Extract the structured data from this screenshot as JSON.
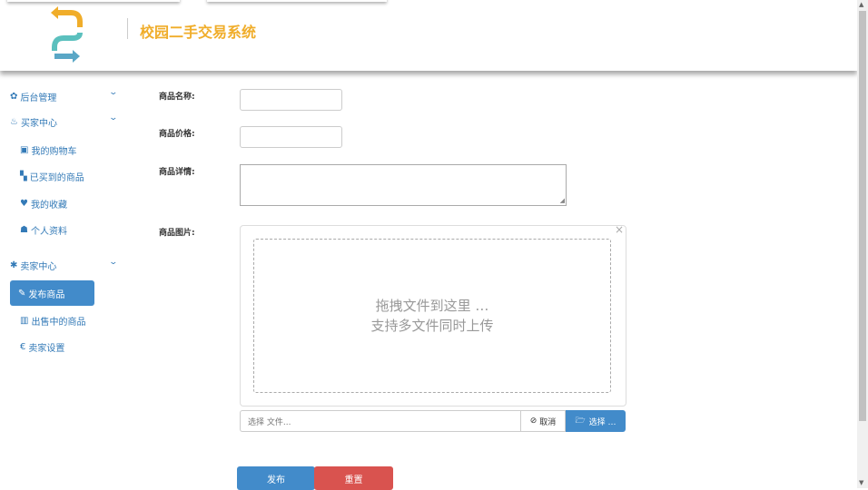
{
  "header": {
    "title": "校园二手交易系统"
  },
  "sidebar": {
    "sections": [
      {
        "label": "后台管理",
        "icon": "gear-icon"
      },
      {
        "label": "买家中心",
        "icon": "fire-icon"
      },
      {
        "label": "卖家中心",
        "icon": "asterisk-icon"
      }
    ],
    "buyer_items": [
      {
        "label": "我的购物车",
        "icon": "inbox-icon"
      },
      {
        "label": "已买到的商品",
        "icon": "gift-icon"
      },
      {
        "label": "我的收藏",
        "icon": "heart-icon"
      },
      {
        "label": "个人资料",
        "icon": "user-icon"
      }
    ],
    "seller_items": [
      {
        "label": "发布商品",
        "icon": "pencil-icon",
        "active": true
      },
      {
        "label": "出售中的商品",
        "icon": "barcode-icon"
      },
      {
        "label": "卖家设置",
        "icon": "euro-icon"
      }
    ]
  },
  "form": {
    "name_label": "商品名称:",
    "price_label": "商品价格:",
    "detail_label": "商品详情:",
    "image_label": "商品图片:",
    "drop_line1": "拖拽文件到这里 …",
    "drop_line2": "支持多文件同时上传",
    "file_placeholder": "选择 文件...",
    "cancel_label": "取消",
    "choose_label": "选择 …",
    "submit_label": "发布",
    "reset_label": "重置"
  },
  "colors": {
    "accent": "#428bca",
    "danger": "#d9534f",
    "title": "#f0ad2a"
  }
}
